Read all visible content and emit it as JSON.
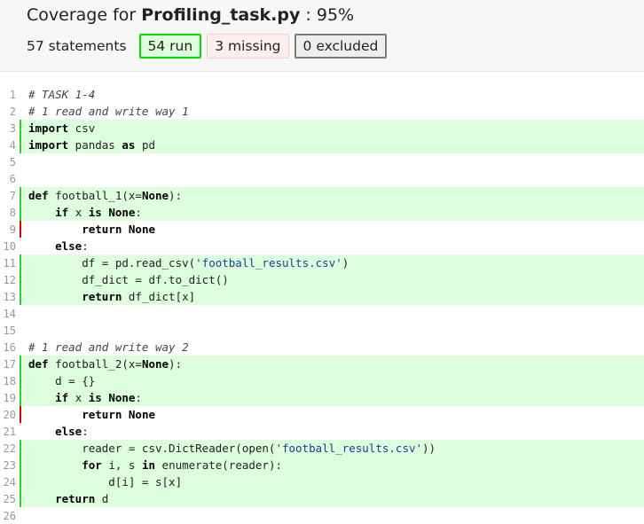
{
  "header": {
    "title_prefix": "Coverage for ",
    "file_name": "Profiling_task.py",
    "title_suffix": " : 95%",
    "statements_label": "57 statements",
    "run_label": "54 run",
    "missing_label": "3 missing",
    "excluded_label": "0 excluded"
  },
  "colors": {
    "run_background": "#ddffdd",
    "run_marker": "#33cc33",
    "missing_marker": "#dd0000"
  },
  "lines": [
    {
      "n": "1",
      "status": "none",
      "tokens": [
        {
          "c": "com",
          "t": "# TASK 1-4"
        }
      ]
    },
    {
      "n": "2",
      "status": "none",
      "tokens": [
        {
          "c": "com",
          "t": "# 1 read and write way 1"
        }
      ]
    },
    {
      "n": "3",
      "status": "run",
      "tokens": [
        {
          "c": "kw",
          "t": "import"
        },
        {
          "c": "",
          "t": " csv"
        }
      ]
    },
    {
      "n": "4",
      "status": "run",
      "tokens": [
        {
          "c": "kw",
          "t": "import"
        },
        {
          "c": "",
          "t": " pandas "
        },
        {
          "c": "kw",
          "t": "as"
        },
        {
          "c": "",
          "t": " pd"
        }
      ]
    },
    {
      "n": "5",
      "status": "none",
      "tokens": []
    },
    {
      "n": "6",
      "status": "none",
      "tokens": []
    },
    {
      "n": "7",
      "status": "run",
      "tokens": [
        {
          "c": "kw",
          "t": "def"
        },
        {
          "c": "",
          "t": " football_1(x="
        },
        {
          "c": "kw",
          "t": "None"
        },
        {
          "c": "",
          "t": "):"
        }
      ]
    },
    {
      "n": "8",
      "status": "run",
      "tokens": [
        {
          "c": "",
          "t": "    "
        },
        {
          "c": "kw",
          "t": "if"
        },
        {
          "c": "",
          "t": " x "
        },
        {
          "c": "kw",
          "t": "is"
        },
        {
          "c": "",
          "t": " "
        },
        {
          "c": "kw",
          "t": "None"
        },
        {
          "c": "",
          "t": ":"
        }
      ]
    },
    {
      "n": "9",
      "status": "mis",
      "tokens": [
        {
          "c": "",
          "t": "        "
        },
        {
          "c": "kw",
          "t": "return"
        },
        {
          "c": "",
          "t": " "
        },
        {
          "c": "kw",
          "t": "None"
        }
      ]
    },
    {
      "n": "10",
      "status": "none",
      "tokens": [
        {
          "c": "",
          "t": "    "
        },
        {
          "c": "kw",
          "t": "else"
        },
        {
          "c": "",
          "t": ":"
        }
      ]
    },
    {
      "n": "11",
      "status": "run",
      "tokens": [
        {
          "c": "",
          "t": "        df = pd.read_csv("
        },
        {
          "c": "str",
          "t": "'football_results.csv'"
        },
        {
          "c": "",
          "t": ")"
        }
      ]
    },
    {
      "n": "12",
      "status": "run",
      "tokens": [
        {
          "c": "",
          "t": "        df_dict = df.to_dict()"
        }
      ]
    },
    {
      "n": "13",
      "status": "run",
      "tokens": [
        {
          "c": "",
          "t": "        "
        },
        {
          "c": "kw",
          "t": "return"
        },
        {
          "c": "",
          "t": " df_dict[x]"
        }
      ]
    },
    {
      "n": "14",
      "status": "none",
      "tokens": []
    },
    {
      "n": "15",
      "status": "none",
      "tokens": []
    },
    {
      "n": "16",
      "status": "none",
      "tokens": [
        {
          "c": "com",
          "t": "# 1 read and write way 2"
        }
      ]
    },
    {
      "n": "17",
      "status": "run",
      "tokens": [
        {
          "c": "kw",
          "t": "def"
        },
        {
          "c": "",
          "t": " football_2(x="
        },
        {
          "c": "kw",
          "t": "None"
        },
        {
          "c": "",
          "t": "):"
        }
      ]
    },
    {
      "n": "18",
      "status": "run",
      "tokens": [
        {
          "c": "",
          "t": "    d = {}"
        }
      ]
    },
    {
      "n": "19",
      "status": "run",
      "tokens": [
        {
          "c": "",
          "t": "    "
        },
        {
          "c": "kw",
          "t": "if"
        },
        {
          "c": "",
          "t": " x "
        },
        {
          "c": "kw",
          "t": "is"
        },
        {
          "c": "",
          "t": " "
        },
        {
          "c": "kw",
          "t": "None"
        },
        {
          "c": "",
          "t": ":"
        }
      ]
    },
    {
      "n": "20",
      "status": "mis",
      "tokens": [
        {
          "c": "",
          "t": "        "
        },
        {
          "c": "kw",
          "t": "return"
        },
        {
          "c": "",
          "t": " "
        },
        {
          "c": "kw",
          "t": "None"
        }
      ]
    },
    {
      "n": "21",
      "status": "none",
      "tokens": [
        {
          "c": "",
          "t": "    "
        },
        {
          "c": "kw",
          "t": "else"
        },
        {
          "c": "",
          "t": ":"
        }
      ]
    },
    {
      "n": "22",
      "status": "run",
      "tokens": [
        {
          "c": "",
          "t": "        reader = csv.DictReader(open("
        },
        {
          "c": "str",
          "t": "'football_results.csv'"
        },
        {
          "c": "",
          "t": "))"
        }
      ]
    },
    {
      "n": "23",
      "status": "run",
      "tokens": [
        {
          "c": "",
          "t": "        "
        },
        {
          "c": "kw",
          "t": "for"
        },
        {
          "c": "",
          "t": " i, s "
        },
        {
          "c": "kw",
          "t": "in"
        },
        {
          "c": "",
          "t": " enumerate(reader):"
        }
      ]
    },
    {
      "n": "24",
      "status": "run",
      "tokens": [
        {
          "c": "",
          "t": "            d[i] = s[x]"
        }
      ]
    },
    {
      "n": "25",
      "status": "run",
      "tokens": [
        {
          "c": "",
          "t": "    "
        },
        {
          "c": "kw",
          "t": "return"
        },
        {
          "c": "",
          "t": " d"
        }
      ]
    },
    {
      "n": "26",
      "status": "none",
      "tokens": []
    }
  ]
}
